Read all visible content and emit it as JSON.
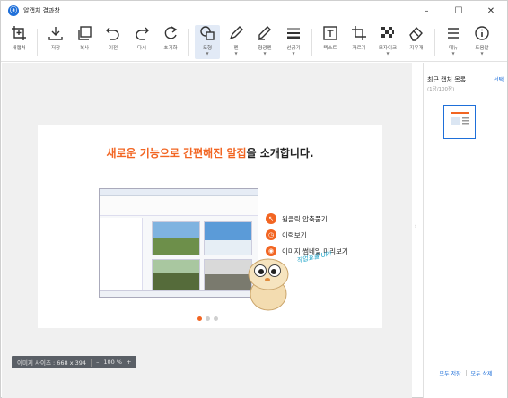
{
  "window": {
    "title": "알캡처 결과창"
  },
  "window_controls": {
    "minimize": "–",
    "maximize": "☐",
    "close": "✕"
  },
  "toolbar": {
    "items": [
      {
        "label": "새캡처",
        "icon": "new-capture-icon"
      },
      {
        "label": "저장",
        "icon": "save-icon"
      },
      {
        "label": "복사",
        "icon": "copy-icon"
      },
      {
        "label": "이전",
        "icon": "undo-icon"
      },
      {
        "label": "다시",
        "icon": "redo-icon"
      },
      {
        "label": "초기화",
        "icon": "reset-icon"
      },
      {
        "label": "도형",
        "icon": "shape-icon",
        "selected": true
      },
      {
        "label": "펜",
        "icon": "pen-icon"
      },
      {
        "label": "형광펜",
        "icon": "highlighter-icon"
      },
      {
        "label": "선굵기",
        "icon": "line-width-icon"
      },
      {
        "label": "텍스트",
        "icon": "text-icon"
      },
      {
        "label": "자르기",
        "icon": "crop-icon"
      },
      {
        "label": "모자이크",
        "icon": "mosaic-icon"
      },
      {
        "label": "지우개",
        "icon": "eraser-icon"
      },
      {
        "label": "메뉴",
        "icon": "menu-icon"
      },
      {
        "label": "도움말",
        "icon": "help-icon"
      }
    ]
  },
  "canvas": {
    "headline_highlight": "새로운 기능으로 간편해진 알집",
    "headline_rest": "을 소개합니다.",
    "features": [
      "원클릭 압축풀기",
      "이력보기",
      "이미지 썸네일 미리보기"
    ],
    "script_text": "작업효율 UP!"
  },
  "statusbar": {
    "image_size": "이미지 사이즈 : 668 x 394",
    "zoom_minus": "–",
    "zoom": "100 %",
    "zoom_plus": "+"
  },
  "right_panel": {
    "title": "최근 캡처 목록",
    "count": "(1장/100장)",
    "select_label": "선택",
    "save_all": "모두 저장",
    "delete_all": "모두 삭제"
  },
  "colors": {
    "accent": "#f26522",
    "brand": "#1e6fd9",
    "statusbar": "#5a5f66"
  }
}
